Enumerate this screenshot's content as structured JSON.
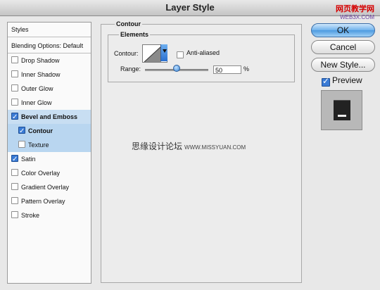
{
  "window": {
    "title": "Layer Style"
  },
  "watermark": {
    "site_cn": "网页教学网",
    "site_url": "WEB3X.COM"
  },
  "sidebar": {
    "header": "Styles",
    "blending": "Blending Options: Default",
    "items": [
      {
        "label": "Drop Shadow",
        "checked": false,
        "selected": false,
        "sub": false
      },
      {
        "label": "Inner Shadow",
        "checked": false,
        "selected": false,
        "sub": false
      },
      {
        "label": "Outer Glow",
        "checked": false,
        "selected": false,
        "sub": false
      },
      {
        "label": "Inner Glow",
        "checked": false,
        "selected": false,
        "sub": false
      },
      {
        "label": "Bevel and Emboss",
        "checked": true,
        "selected": true,
        "sub": false
      },
      {
        "label": "Contour",
        "checked": true,
        "selected": true,
        "sub": true
      },
      {
        "label": "Texture",
        "checked": false,
        "selected": true,
        "sub": true
      },
      {
        "label": "Satin",
        "checked": true,
        "selected": false,
        "sub": false
      },
      {
        "label": "Color Overlay",
        "checked": false,
        "selected": false,
        "sub": false
      },
      {
        "label": "Gradient Overlay",
        "checked": false,
        "selected": false,
        "sub": false
      },
      {
        "label": "Pattern Overlay",
        "checked": false,
        "selected": false,
        "sub": false
      },
      {
        "label": "Stroke",
        "checked": false,
        "selected": false,
        "sub": false
      }
    ]
  },
  "panel": {
    "title": "Contour",
    "group_title": "Elements",
    "contour_label": "Contour:",
    "anti_aliased_label": "Anti-aliased",
    "anti_aliased": false,
    "range_label": "Range:",
    "range_value": "50",
    "range_unit": "%",
    "range_level": 0.5
  },
  "buttons": {
    "ok": "OK",
    "cancel": "Cancel",
    "new_style": "New Style...",
    "preview_label": "Preview",
    "preview_checked": true
  },
  "overlay_text": {
    "cn": "思缘设计论坛",
    "url": "WWW.MISSYUAN.COM"
  }
}
